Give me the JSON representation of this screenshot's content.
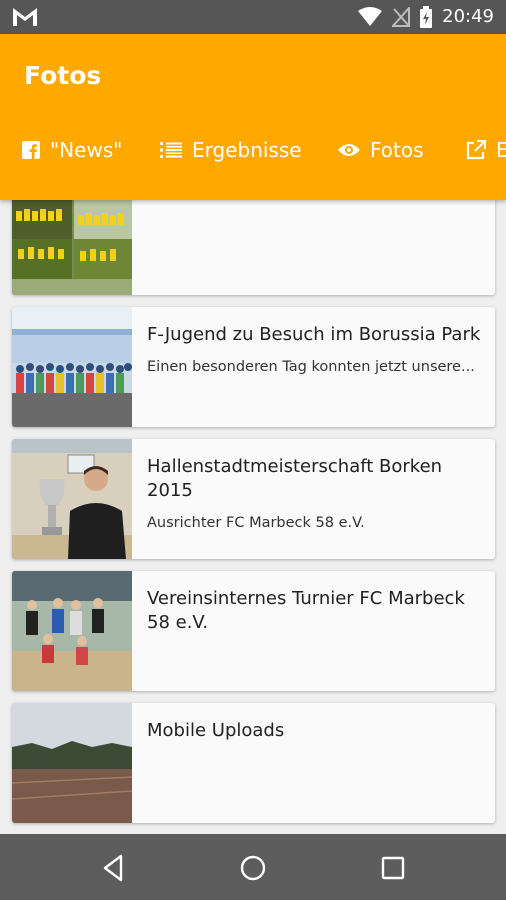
{
  "status_bar": {
    "time": "20:49",
    "icons": [
      "gmail-icon",
      "wifi-icon",
      "no-signal-icon",
      "battery-charging-icon"
    ]
  },
  "app_bar": {
    "title": "Fotos",
    "color": "#ffa800"
  },
  "tabs": [
    {
      "label": "\"News\"",
      "icon": "facebook-icon"
    },
    {
      "label": "Ergebnisse",
      "icon": "list-icon"
    },
    {
      "label": "Fotos",
      "icon": "eye-icon"
    },
    {
      "label": "E",
      "icon": "external-link-icon"
    }
  ],
  "albums": [
    {
      "title": "",
      "subtitle": "",
      "thumb": "team-photo-collage"
    },
    {
      "title": "F-Jugend zu Besuch im Borussia Park",
      "subtitle": "Einen besonderen Tag konnten jetzt unsere...",
      "thumb": "group-photo-bus"
    },
    {
      "title": "Hallenstadtmeisterschaft Borken 2015",
      "subtitle": "Ausrichter FC Marbeck 58 e.V.",
      "thumb": "man-with-trophy"
    },
    {
      "title": "Vereinsinternes Turnier FC Marbeck 58 e.V.",
      "subtitle": "",
      "thumb": "players-in-gym"
    },
    {
      "title": "Mobile Uploads",
      "subtitle": "",
      "thumb": "sports-field"
    }
  ],
  "nav_bar": {
    "icons": [
      "back-icon",
      "home-icon",
      "recents-icon"
    ]
  }
}
